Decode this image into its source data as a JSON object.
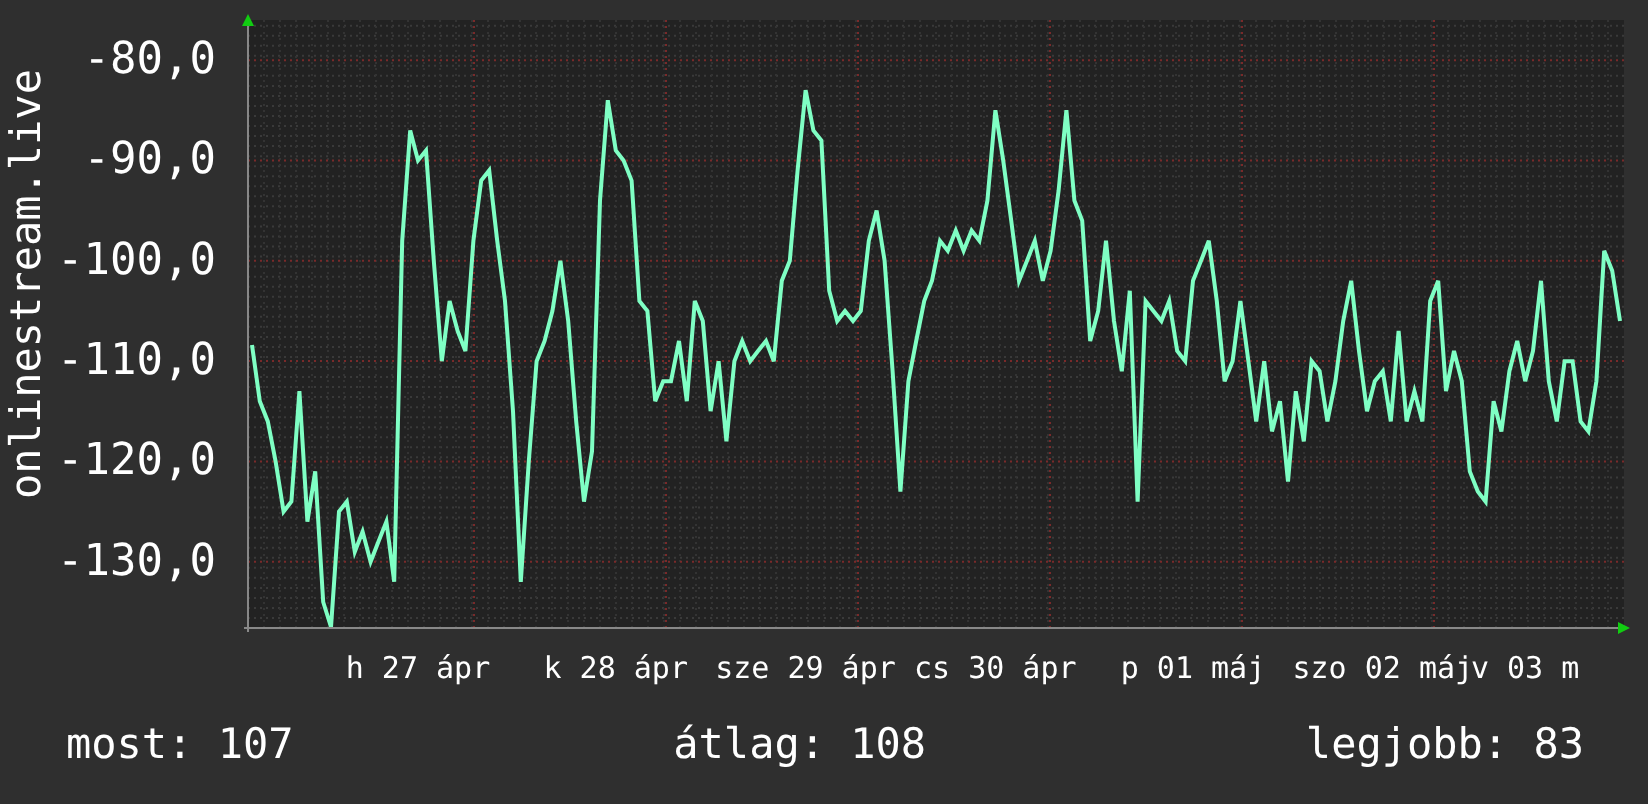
{
  "graph": {
    "chart_data": {
      "type": "line",
      "grid": true,
      "ylabel": "onlinestream.live",
      "categories": [
        null,
        null,
        null,
        null,
        null,
        null,
        null,
        null,
        null,
        null,
        null,
        null,
        null,
        null,
        null,
        null,
        null,
        null,
        null,
        null,
        null,
        "h 27 ápr",
        null,
        null,
        null,
        null,
        null,
        null,
        null,
        null,
        null,
        null,
        null,
        null,
        null,
        null,
        null,
        null,
        null,
        null,
        null,
        null,
        null,
        null,
        null,
        null,
        "k 28 ápr",
        null,
        null,
        null,
        null,
        null,
        null,
        null,
        null,
        null,
        null,
        null,
        null,
        null,
        null,
        null,
        null,
        null,
        null,
        null,
        null,
        null,
        null,
        null,
        "sze 29 ápr",
        null,
        null,
        null,
        null,
        null,
        null,
        null,
        null,
        null,
        null,
        null,
        null,
        null,
        null,
        null,
        null,
        null,
        null,
        null,
        null,
        null,
        null,
        null,
        "cs 30 ápr",
        null,
        null,
        null,
        null,
        null,
        null,
        null,
        null,
        null,
        null,
        null,
        null,
        null,
        null,
        null,
        null,
        null,
        null,
        null,
        null,
        null,
        null,
        null,
        null,
        "p 01 máj",
        null,
        null,
        null,
        null,
        null,
        null,
        null,
        null,
        null,
        null,
        null,
        null,
        null,
        null,
        null,
        null,
        null,
        null,
        null,
        null,
        null,
        null,
        null,
        "szo 02 máj",
        null,
        null,
        null,
        null,
        null,
        null,
        null,
        null,
        null,
        null,
        null,
        null,
        null,
        null,
        null,
        null,
        null,
        "v 03 m",
        null,
        null,
        null,
        null,
        null,
        null,
        null,
        null,
        null,
        null,
        null,
        null
      ],
      "ylim": [
        -136.6,
        -76
      ],
      "yticks": [
        {
          "value": -80,
          "label": "-80,0"
        },
        {
          "value": -90,
          "label": "-90,0"
        },
        {
          "value": -100,
          "label": "-100,0"
        },
        {
          "value": -110,
          "label": "-110,0"
        },
        {
          "value": -120,
          "label": "-120,0"
        },
        {
          "value": -130,
          "label": "-130,0"
        }
      ],
      "series": [
        {
          "color": "#7fffc4",
          "values": [
            -108.4,
            -114,
            -116,
            -120,
            -125,
            -124,
            -113,
            -126,
            -121,
            -134,
            -136.5,
            -125,
            -124,
            -129,
            -127,
            -130,
            -128,
            -126,
            -132,
            -98,
            -87,
            -90,
            -89,
            -100,
            -110,
            -104,
            -107,
            -109,
            -98,
            -92,
            -91,
            -98,
            -104,
            -115,
            -132,
            -120,
            -110,
            -108,
            -105,
            -100,
            -106,
            -116,
            -124,
            -119,
            -94,
            -84,
            -89,
            -90,
            -92,
            -104,
            -105,
            -114,
            -112,
            -112,
            -108,
            -114,
            -104,
            -106,
            -115,
            -110,
            -118,
            -110,
            -108,
            -110,
            -109,
            -108,
            -110,
            -102,
            -100,
            -91,
            -83,
            -87,
            -88,
            -103,
            -106,
            -105,
            -106,
            -105,
            -98,
            -95,
            -100,
            -111,
            -123,
            -112,
            -108,
            -104,
            -102,
            -98,
            -99,
            -97,
            -99,
            -97,
            -98,
            -94,
            -85,
            -90,
            -96,
            -102,
            -100,
            -98,
            -102,
            -99,
            -93,
            -85,
            -94,
            -96,
            -108,
            -105,
            -98,
            -106,
            -111,
            -103,
            -124,
            -104,
            -105,
            -106,
            -104,
            -109,
            -110,
            -102,
            -100,
            -98,
            -104,
            -112,
            -110,
            -104,
            -110,
            -116,
            -110,
            -117,
            -114,
            -122,
            -113,
            -118,
            -110,
            -111,
            -116,
            -112,
            -106,
            -102,
            -109,
            -115,
            -112,
            -111,
            -116,
            -107,
            -116,
            -113,
            -116,
            -104,
            -102,
            -113,
            -109,
            -112,
            -121,
            -123,
            -124,
            -114,
            -117,
            -111,
            -108,
            -112,
            -109,
            -102,
            -112,
            -116,
            -110,
            -110,
            -116,
            -117,
            -112,
            -99,
            -101,
            -106
          ]
        }
      ]
    }
  },
  "stats": [
    "most: 107",
    "átlag: 108",
    "legjobb: 83"
  ]
}
